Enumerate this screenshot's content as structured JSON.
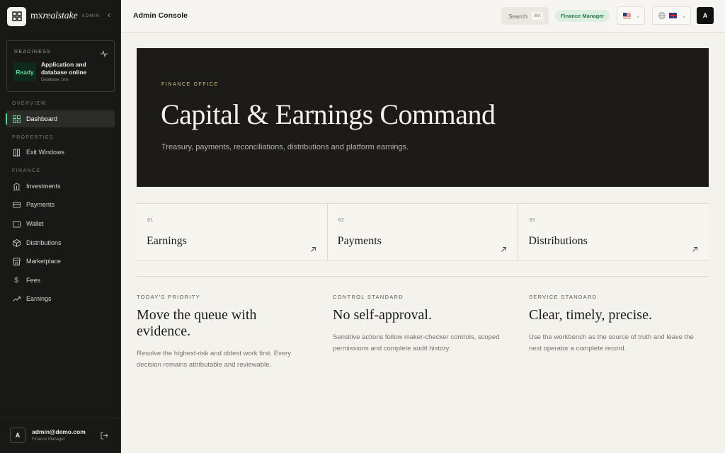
{
  "brand": {
    "name_prefix": "mx",
    "name_suffix": "realstake",
    "tag": "ADMIN"
  },
  "readiness": {
    "heading": "READINESS",
    "badge": "Ready",
    "title": "Application and database online",
    "subtitle": "Database 1ms"
  },
  "sidebar": {
    "sections": {
      "overview": "OVERVIEW",
      "properties": "PROPERTIES",
      "finance": "FINANCE"
    },
    "items": [
      {
        "label": "Dashboard",
        "icon": "grid-icon",
        "active": true
      },
      {
        "label": "Exit Windows",
        "icon": "columns-icon"
      },
      {
        "label": "Investments",
        "icon": "bank-icon"
      },
      {
        "label": "Payments",
        "icon": "card-icon"
      },
      {
        "label": "Wallet",
        "icon": "wallet-icon"
      },
      {
        "label": "Distributions",
        "icon": "box-icon"
      },
      {
        "label": "Marketplace",
        "icon": "store-icon"
      },
      {
        "label": "Fees",
        "icon": "dollar-icon"
      },
      {
        "label": "Earnings",
        "icon": "trend-icon"
      }
    ]
  },
  "user": {
    "initial": "A",
    "email": "admin@demo.com",
    "role": "Finance Manager"
  },
  "topbar": {
    "title": "Admin Console",
    "search_label": "Search",
    "search_shortcut": "⌘K",
    "role_badge": "Finance Manager",
    "avatar_initial": "A"
  },
  "hero": {
    "kicker": "FINANCE OFFICE",
    "title": "Capital & Earnings Command",
    "description": "Treasury, payments, reconciliations, distributions and platform earnings."
  },
  "cards": [
    {
      "num": "01",
      "label": "Earnings"
    },
    {
      "num": "02",
      "label": "Payments"
    },
    {
      "num": "03",
      "label": "Distributions"
    }
  ],
  "columns": [
    {
      "kicker": "TODAY'S PRIORITY",
      "title": "Move the queue with evidence.",
      "body": "Resolve the highest-risk and oldest work first. Every decision remains attributable and reviewable."
    },
    {
      "kicker": "CONTROL STANDARD",
      "title": "No self-approval.",
      "body": "Sensitive actions follow maker-checker controls, scoped permissions and complete audit history."
    },
    {
      "kicker": "SERVICE STANDARD",
      "title": "Clear, timely, precise.",
      "body": "Use the workbench as the source of truth and leave the next operator a complete record."
    }
  ],
  "colors": {
    "accent": "#5fcf91",
    "hero_bg": "#1c1b18",
    "sidebar_bg": "#181816",
    "kicker_gold": "#d2c27e"
  }
}
